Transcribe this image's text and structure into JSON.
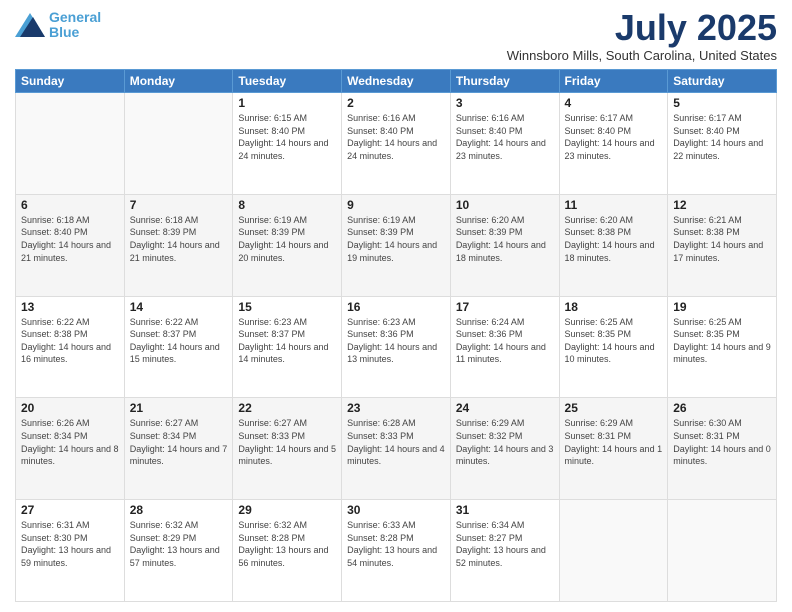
{
  "logo": {
    "line1": "General",
    "line2": "Blue"
  },
  "title": "July 2025",
  "location": "Winnsboro Mills, South Carolina, United States",
  "days_of_week": [
    "Sunday",
    "Monday",
    "Tuesday",
    "Wednesday",
    "Thursday",
    "Friday",
    "Saturday"
  ],
  "weeks": [
    [
      {
        "day": "",
        "sunrise": "",
        "sunset": "",
        "daylight": ""
      },
      {
        "day": "",
        "sunrise": "",
        "sunset": "",
        "daylight": ""
      },
      {
        "day": "1",
        "sunrise": "Sunrise: 6:15 AM",
        "sunset": "Sunset: 8:40 PM",
        "daylight": "Daylight: 14 hours and 24 minutes."
      },
      {
        "day": "2",
        "sunrise": "Sunrise: 6:16 AM",
        "sunset": "Sunset: 8:40 PM",
        "daylight": "Daylight: 14 hours and 24 minutes."
      },
      {
        "day": "3",
        "sunrise": "Sunrise: 6:16 AM",
        "sunset": "Sunset: 8:40 PM",
        "daylight": "Daylight: 14 hours and 23 minutes."
      },
      {
        "day": "4",
        "sunrise": "Sunrise: 6:17 AM",
        "sunset": "Sunset: 8:40 PM",
        "daylight": "Daylight: 14 hours and 23 minutes."
      },
      {
        "day": "5",
        "sunrise": "Sunrise: 6:17 AM",
        "sunset": "Sunset: 8:40 PM",
        "daylight": "Daylight: 14 hours and 22 minutes."
      }
    ],
    [
      {
        "day": "6",
        "sunrise": "Sunrise: 6:18 AM",
        "sunset": "Sunset: 8:40 PM",
        "daylight": "Daylight: 14 hours and 21 minutes."
      },
      {
        "day": "7",
        "sunrise": "Sunrise: 6:18 AM",
        "sunset": "Sunset: 8:39 PM",
        "daylight": "Daylight: 14 hours and 21 minutes."
      },
      {
        "day": "8",
        "sunrise": "Sunrise: 6:19 AM",
        "sunset": "Sunset: 8:39 PM",
        "daylight": "Daylight: 14 hours and 20 minutes."
      },
      {
        "day": "9",
        "sunrise": "Sunrise: 6:19 AM",
        "sunset": "Sunset: 8:39 PM",
        "daylight": "Daylight: 14 hours and 19 minutes."
      },
      {
        "day": "10",
        "sunrise": "Sunrise: 6:20 AM",
        "sunset": "Sunset: 8:39 PM",
        "daylight": "Daylight: 14 hours and 18 minutes."
      },
      {
        "day": "11",
        "sunrise": "Sunrise: 6:20 AM",
        "sunset": "Sunset: 8:38 PM",
        "daylight": "Daylight: 14 hours and 18 minutes."
      },
      {
        "day": "12",
        "sunrise": "Sunrise: 6:21 AM",
        "sunset": "Sunset: 8:38 PM",
        "daylight": "Daylight: 14 hours and 17 minutes."
      }
    ],
    [
      {
        "day": "13",
        "sunrise": "Sunrise: 6:22 AM",
        "sunset": "Sunset: 8:38 PM",
        "daylight": "Daylight: 14 hours and 16 minutes."
      },
      {
        "day": "14",
        "sunrise": "Sunrise: 6:22 AM",
        "sunset": "Sunset: 8:37 PM",
        "daylight": "Daylight: 14 hours and 15 minutes."
      },
      {
        "day": "15",
        "sunrise": "Sunrise: 6:23 AM",
        "sunset": "Sunset: 8:37 PM",
        "daylight": "Daylight: 14 hours and 14 minutes."
      },
      {
        "day": "16",
        "sunrise": "Sunrise: 6:23 AM",
        "sunset": "Sunset: 8:36 PM",
        "daylight": "Daylight: 14 hours and 13 minutes."
      },
      {
        "day": "17",
        "sunrise": "Sunrise: 6:24 AM",
        "sunset": "Sunset: 8:36 PM",
        "daylight": "Daylight: 14 hours and 11 minutes."
      },
      {
        "day": "18",
        "sunrise": "Sunrise: 6:25 AM",
        "sunset": "Sunset: 8:35 PM",
        "daylight": "Daylight: 14 hours and 10 minutes."
      },
      {
        "day": "19",
        "sunrise": "Sunrise: 6:25 AM",
        "sunset": "Sunset: 8:35 PM",
        "daylight": "Daylight: 14 hours and 9 minutes."
      }
    ],
    [
      {
        "day": "20",
        "sunrise": "Sunrise: 6:26 AM",
        "sunset": "Sunset: 8:34 PM",
        "daylight": "Daylight: 14 hours and 8 minutes."
      },
      {
        "day": "21",
        "sunrise": "Sunrise: 6:27 AM",
        "sunset": "Sunset: 8:34 PM",
        "daylight": "Daylight: 14 hours and 7 minutes."
      },
      {
        "day": "22",
        "sunrise": "Sunrise: 6:27 AM",
        "sunset": "Sunset: 8:33 PM",
        "daylight": "Daylight: 14 hours and 5 minutes."
      },
      {
        "day": "23",
        "sunrise": "Sunrise: 6:28 AM",
        "sunset": "Sunset: 8:33 PM",
        "daylight": "Daylight: 14 hours and 4 minutes."
      },
      {
        "day": "24",
        "sunrise": "Sunrise: 6:29 AM",
        "sunset": "Sunset: 8:32 PM",
        "daylight": "Daylight: 14 hours and 3 minutes."
      },
      {
        "day": "25",
        "sunrise": "Sunrise: 6:29 AM",
        "sunset": "Sunset: 8:31 PM",
        "daylight": "Daylight: 14 hours and 1 minute."
      },
      {
        "day": "26",
        "sunrise": "Sunrise: 6:30 AM",
        "sunset": "Sunset: 8:31 PM",
        "daylight": "Daylight: 14 hours and 0 minutes."
      }
    ],
    [
      {
        "day": "27",
        "sunrise": "Sunrise: 6:31 AM",
        "sunset": "Sunset: 8:30 PM",
        "daylight": "Daylight: 13 hours and 59 minutes."
      },
      {
        "day": "28",
        "sunrise": "Sunrise: 6:32 AM",
        "sunset": "Sunset: 8:29 PM",
        "daylight": "Daylight: 13 hours and 57 minutes."
      },
      {
        "day": "29",
        "sunrise": "Sunrise: 6:32 AM",
        "sunset": "Sunset: 8:28 PM",
        "daylight": "Daylight: 13 hours and 56 minutes."
      },
      {
        "day": "30",
        "sunrise": "Sunrise: 6:33 AM",
        "sunset": "Sunset: 8:28 PM",
        "daylight": "Daylight: 13 hours and 54 minutes."
      },
      {
        "day": "31",
        "sunrise": "Sunrise: 6:34 AM",
        "sunset": "Sunset: 8:27 PM",
        "daylight": "Daylight: 13 hours and 52 minutes."
      },
      {
        "day": "",
        "sunrise": "",
        "sunset": "",
        "daylight": ""
      },
      {
        "day": "",
        "sunrise": "",
        "sunset": "",
        "daylight": ""
      }
    ]
  ]
}
